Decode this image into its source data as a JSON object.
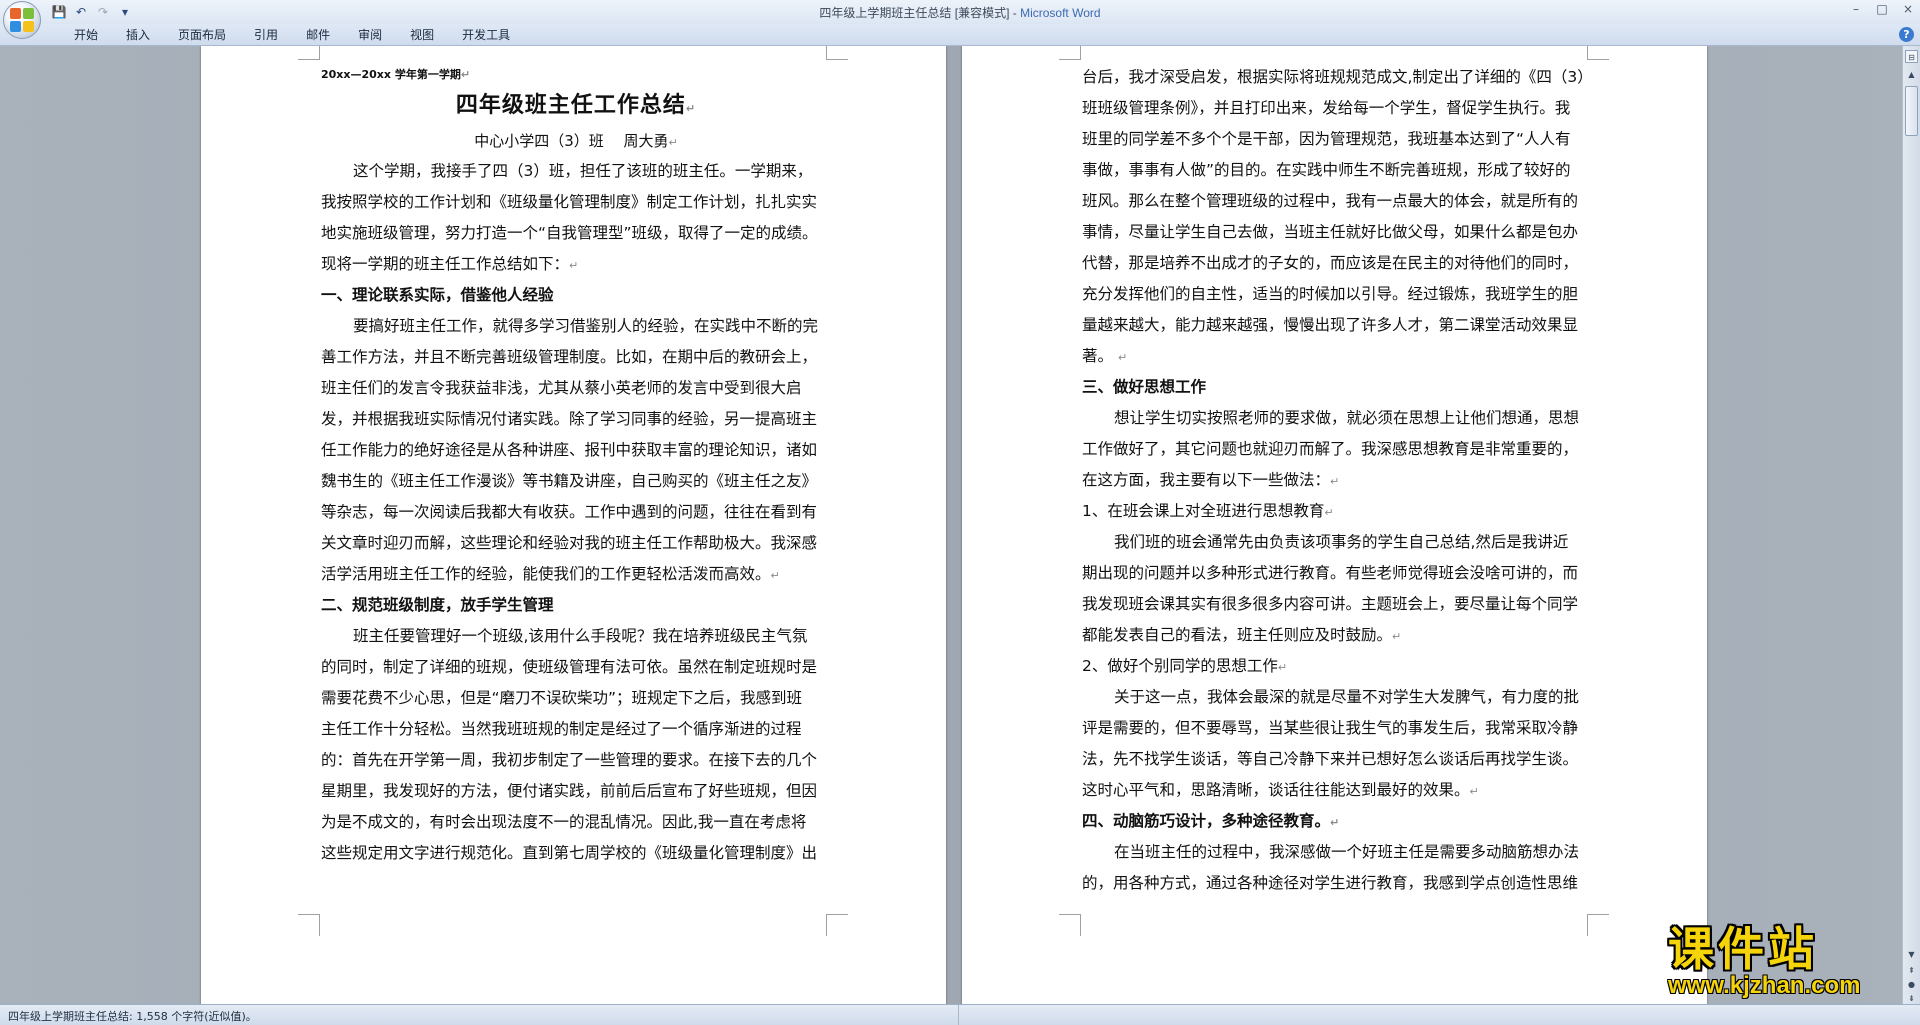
{
  "window": {
    "title": "四年级上学期班主任总结 [兼容模式] - ",
    "app_name": "Microsoft Word",
    "controls": [
      "–",
      "□",
      "×"
    ]
  },
  "quick_access": [
    {
      "name": "save-icon",
      "glyph": "💾"
    },
    {
      "name": "undo-icon",
      "glyph": "↶"
    },
    {
      "name": "redo-icon",
      "glyph": "↷"
    },
    {
      "name": "customize-icon",
      "glyph": "▾"
    }
  ],
  "ribbon": {
    "tabs": [
      "开始",
      "插入",
      "页面布局",
      "引用",
      "邮件",
      "审阅",
      "视图",
      "开发工具"
    ],
    "help": "?"
  },
  "page1": {
    "semester": "20xx—20xx 学年第一学期",
    "title": "四年级班主任工作总结",
    "subtitle": "中心小学四（3）班　 周大勇",
    "lines": [
      {
        "t": "这个学期，我接手了四（3）班，担任了该班的班主任。一学期来，",
        "ind": true
      },
      {
        "t": "我按照学校的工作计划和《班级量化管理制度》制定工作计划，扎扎实实"
      },
      {
        "t": "地实施班级管理，努力打造一个“自我管理型”班级，取得了一定的成绩。"
      },
      {
        "t": "现将一学期的班主任工作总结如下：",
        "pm": "↵"
      },
      {
        "t": "一、理论联系实际，借鉴他人经验",
        "h": true
      },
      {
        "t": "要搞好班主任工作，就得多学习借鉴别人的经验，在实践中不断的完",
        "ind": true
      },
      {
        "t": "善工作方法，并且不断完善班级管理制度。比如，在期中后的教研会上，"
      },
      {
        "t": "班主任们的发言令我获益非浅，尤其从蔡小英老师的发言中受到很大启"
      },
      {
        "t": "发，并根据我班实际情况付诸实践。除了学习同事的经验，另一提高班主"
      },
      {
        "t": "任工作能力的绝好途径是从各种讲座、报刊中获取丰富的理论知识，诸如"
      },
      {
        "t": "魏书生的《班主任工作漫谈》等书籍及讲座，自己购买的《班主任之友》"
      },
      {
        "t": "等杂志，每一次阅读后我都大有收获。工作中遇到的问题，往往在看到有"
      },
      {
        "t": "关文章时迎刃而解，这些理论和经验对我的班主任工作帮助极大。我深感"
      },
      {
        "t": "活学活用班主任工作的经验，能使我们的工作更轻松活泼而高效。",
        "pm": "↵"
      },
      {
        "t": "二、规范班级制度，放手学生管理",
        "h": true
      },
      {
        "t": "班主任要管理好一个班级,该用什么手段呢？我在培养班级民主气氛",
        "ind": true
      },
      {
        "t": "的同时，制定了详细的班规，使班级管理有法可依。虽然在制定班规时是"
      },
      {
        "t": "需要花费不少心思，但是“磨刀不误砍柴功”；班规定下之后，我感到班"
      },
      {
        "t": "主任工作十分轻松。当然我班班规的制定是经过了一个循序渐进的过程"
      },
      {
        "t": "的：首先在开学第一周，我初步制定了一些管理的要求。在接下去的几个"
      },
      {
        "t": "星期里，我发现好的方法，便付诸实践，前前后后宣布了好些班规，但因"
      },
      {
        "t": "为是不成文的，有时会出现法度不一的混乱情况。因此,我一直在考虑将"
      },
      {
        "t": "这些规定用文字进行规范化。直到第七周学校的《班级量化管理制度》出"
      }
    ]
  },
  "page2": {
    "lines": [
      {
        "t": "台后，我才深受启发，根据实际将班规规范成文,制定出了详细的《四（3）"
      },
      {
        "t": "班班级管理条例》，并且打印出来，发给每一个学生，督促学生执行。我"
      },
      {
        "t": "班里的同学差不多个个是干部，因为管理规范，我班基本达到了“人人有"
      },
      {
        "t": "事做，事事有人做”的目的。在实践中师生不断完善班规，形成了较好的"
      },
      {
        "t": "班风。那么在整个管理班级的过程中，我有一点最大的体会，就是所有的"
      },
      {
        "t": "事情，尽量让学生自己去做，当班主任就好比做父母，如果什么都是包办"
      },
      {
        "t": "代替，那是培养不出成才的子女的，而应该是在民主的对待他们的同时，"
      },
      {
        "t": "充分发挥他们的自主性，适当的时候加以引导。经过锻炼，我班学生的胆"
      },
      {
        "t": "量越来越大，能力越来越强，慢慢出现了许多人才，第二课堂活动效果显"
      },
      {
        "t": "著。 ",
        "pm": "↵"
      },
      {
        "t": "三、做好思想工作",
        "h": true
      },
      {
        "t": "想让学生切实按照老师的要求做，就必须在思想上让他们想通，思想",
        "ind": true
      },
      {
        "t": "工作做好了，其它问题也就迎刃而解了。我深感思想教育是非常重要的，"
      },
      {
        "t": "在这方面，我主要有以下一些做法：",
        "pm": "↵"
      },
      {
        "t": "1、在班会课上对全班进行思想教育",
        "pm": "↵"
      },
      {
        "t": "我们班的班会通常先由负责该项事务的学生自己总结,然后是我讲近",
        "ind": true
      },
      {
        "t": "期出现的问题并以多种形式进行教育。有些老师觉得班会没啥可讲的，而"
      },
      {
        "t": "我发现班会课其实有很多很多内容可讲。主题班会上，要尽量让每个同学"
      },
      {
        "t": "都能发表自己的看法，班主任则应及时鼓励。",
        "pm": "↵"
      },
      {
        "t": "2、做好个别同学的思想工作",
        "pm": "↵"
      },
      {
        "t": "关于这一点，我体会最深的就是尽量不对学生大发脾气，有力度的批",
        "ind": true
      },
      {
        "t": "评是需要的，但不要辱骂，当某些很让我生气的事发生后，我常采取冷静"
      },
      {
        "t": "法，先不找学生谈话，等自己冷静下来并已想好怎么谈话后再找学生谈。"
      },
      {
        "t": "这时心平气和，思路清晰，谈话往往能达到最好的效果。",
        "pm": "↵"
      },
      {
        "t": "四、动脑筋巧设计，多种途径教育。",
        "h": true,
        "pm": "↵"
      },
      {
        "t": "在当班主任的过程中，我深感做一个好班主任是需要多动脑筋想办法",
        "ind": true
      },
      {
        "t": "的，用各种方式，通过各种途径对学生进行教育，我感到学点创造性思维"
      }
    ]
  },
  "status": {
    "text": "四年级上学期班主任总结: 1,558 个字符(近似值)。"
  },
  "watermark": {
    "cn": "课件站",
    "url": "www.kjzhan.com"
  }
}
